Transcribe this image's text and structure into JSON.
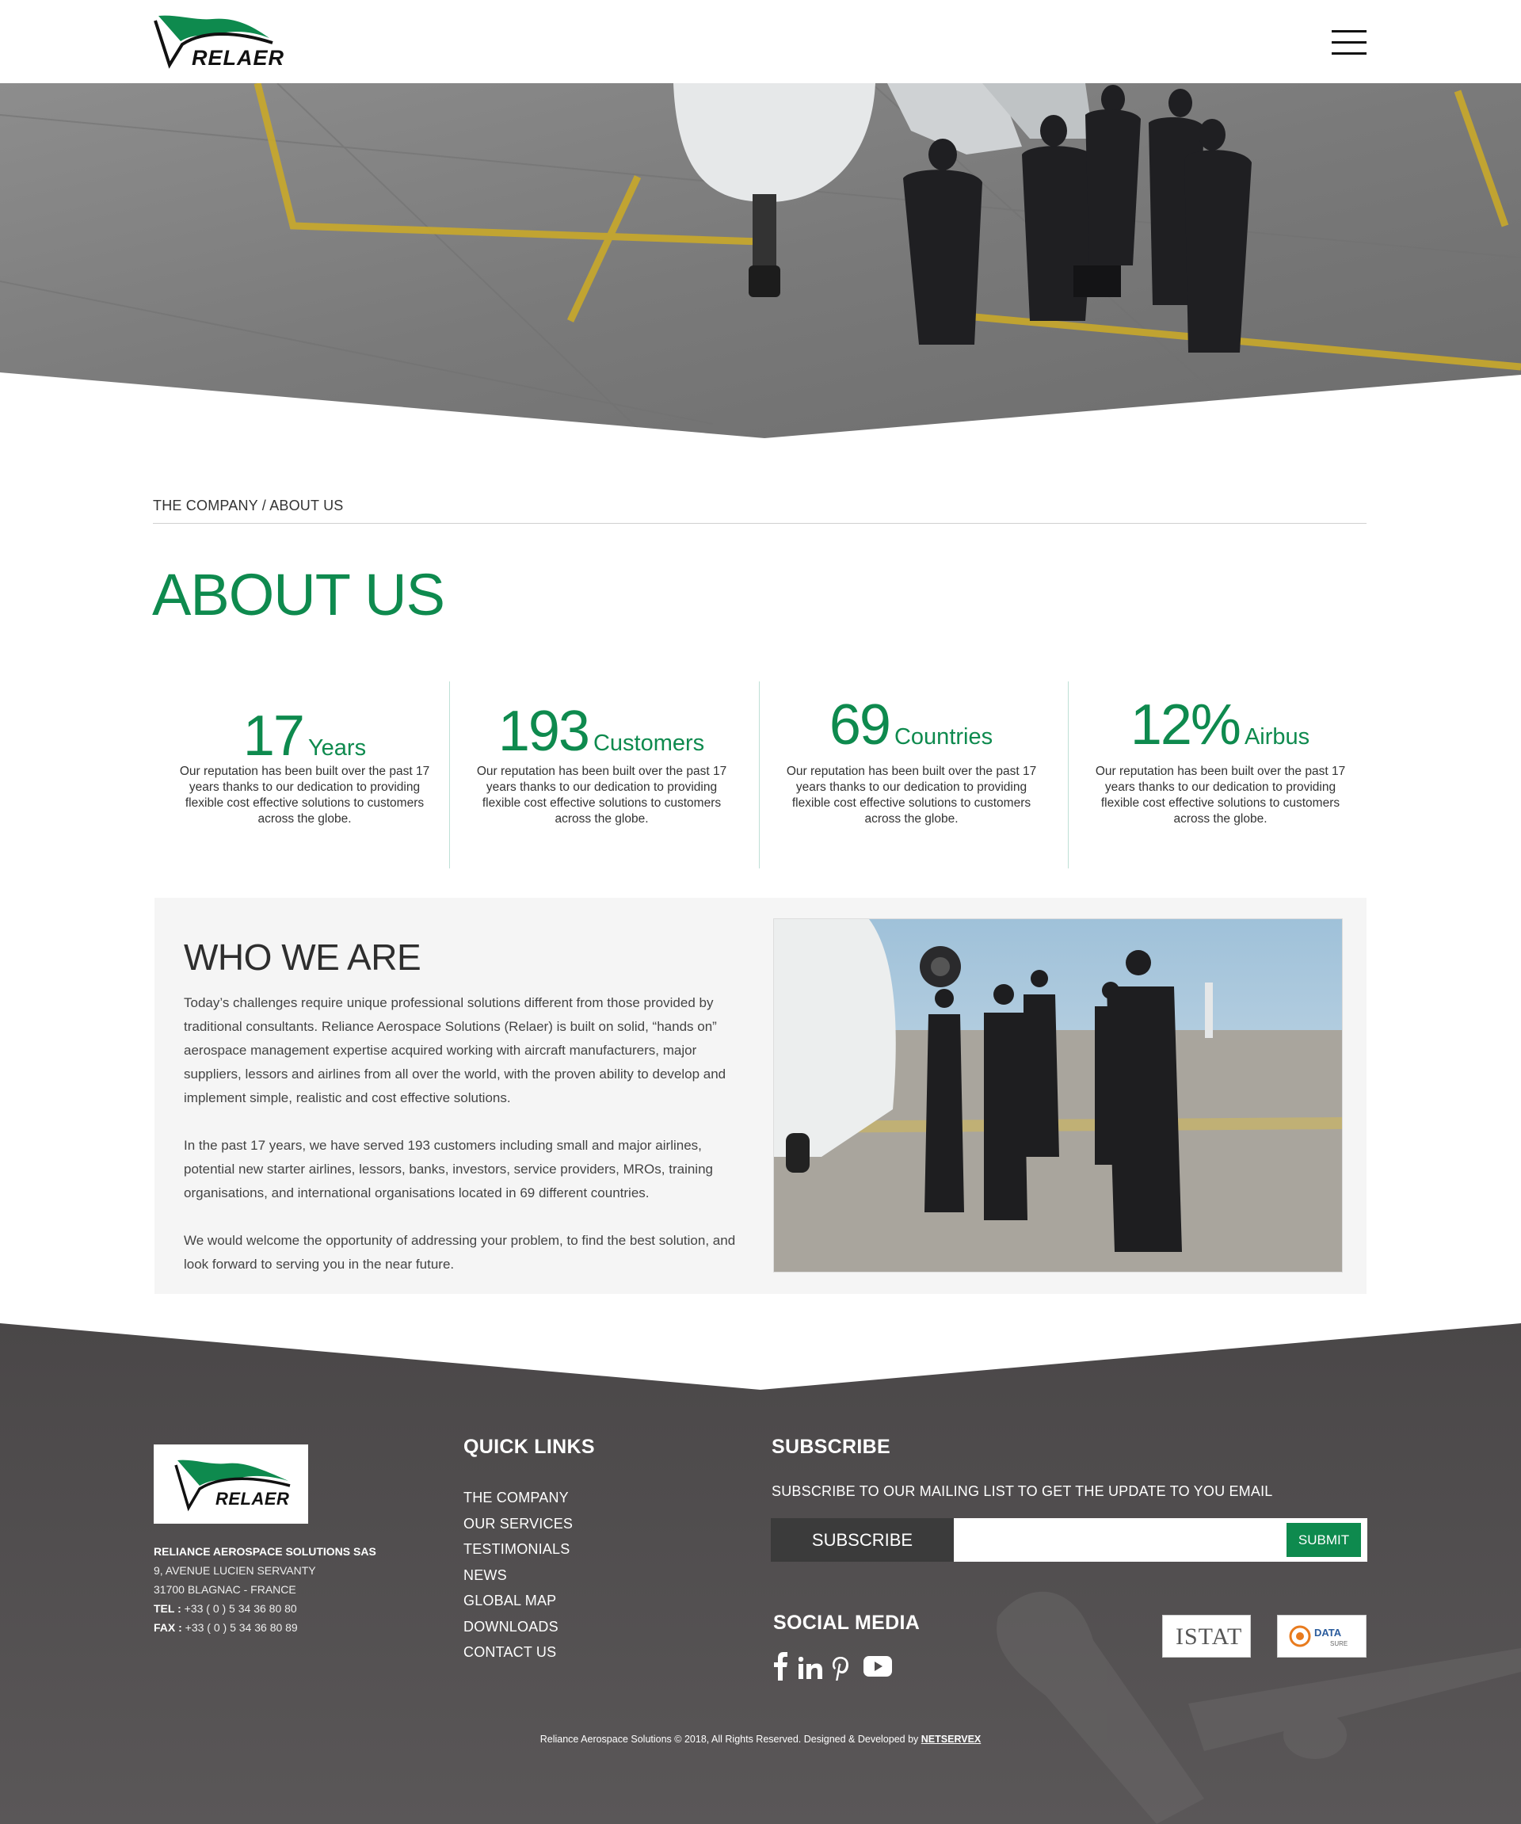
{
  "brand": {
    "name": "RELAER",
    "green": "#0e8a4e"
  },
  "header": {
    "menu_icon": "hamburger-menu-icon"
  },
  "breadcrumb": {
    "parent": "THE COMPANY",
    "separator": " / ",
    "current": "ABOUT US"
  },
  "page": {
    "title": "ABOUT US"
  },
  "stats": [
    {
      "number": "17",
      "unit": "Years",
      "description": "Our reputation has been built over the past 17 years thanks to our dedication to providing flexible cost effective solutions to customers across the globe."
    },
    {
      "number": "193",
      "unit": "Customers",
      "description": "Our reputation has been built over the past 17 years thanks to our dedication to providing flexible cost effective solutions to customers across the globe."
    },
    {
      "number": "69",
      "unit": "Countries",
      "description": "Our reputation has been built over the past 17 years thanks to our dedication to providing flexible cost effective solutions to customers across the globe."
    },
    {
      "number": "12%",
      "unit": "Airbus",
      "description": "Our reputation has been built over the past 17 years thanks to our dedication to providing flexible cost effective solutions to customers across the globe."
    }
  ],
  "who": {
    "title": "WHO WE ARE",
    "paragraphs": [
      "Today’s challenges require unique professional solutions different from those provided by traditional consultants.  Reliance Aerospace Solutions (Relaer) is built on solid, “hands on” aerospace management expertise acquired working with aircraft manufacturers, major suppliers, lessors and airlines from all over the world, with the proven ability to develop and implement simple, realistic and cost effective solutions.",
      "In the past 17 years, we have served 193 customers including small and major airlines, potential new starter airlines, lessors, banks, investors, service providers, MROs, training organisations, and international organisations located in 69 different countries.",
      "We would welcome the opportunity of addressing your problem, to find the best solution, and look forward to serving you in the near future."
    ]
  },
  "footer": {
    "company": {
      "name": "RELIANCE AEROSPACE SOLUTIONS SAS",
      "address1": "9, AVENUE LUCIEN SERVANTY",
      "address2": "31700 BLAGNAC - FRANCE",
      "tel_label": "TEL :",
      "tel": "+33 ( 0 ) 5 34 36 80 80",
      "fax_label": "FAX :",
      "fax": "+33 ( 0 ) 5 34 36 80 89"
    },
    "quick_links": {
      "heading": "QUICK LINKS",
      "items": [
        "THE COMPANY",
        "OUR SERVICES",
        "TESTIMONIALS",
        "NEWS",
        "GLOBAL MAP",
        "DOWNLOADS",
        "CONTACT US"
      ]
    },
    "subscribe": {
      "heading": "SUBSCRIBE",
      "text": "SUBSCRIBE TO OUR MAILING LIST TO GET THE UPDATE TO YOU EMAIL",
      "label": "SUBSCRIBE",
      "input_value": "",
      "button": "SUBMIT"
    },
    "social": {
      "heading": "SOCIAL MEDIA",
      "icons": [
        "facebook-icon",
        "linkedin-icon",
        "pinterest-icon",
        "youtube-icon"
      ]
    },
    "partners": [
      {
        "name": "ISTAT"
      },
      {
        "name": "DATA",
        "sub": "SURE"
      }
    ],
    "copyright": "Reliance Aerospace Solutions © 2018, All Rights Reserved. Designed & Developed by",
    "developer": "NETSERVEX"
  }
}
